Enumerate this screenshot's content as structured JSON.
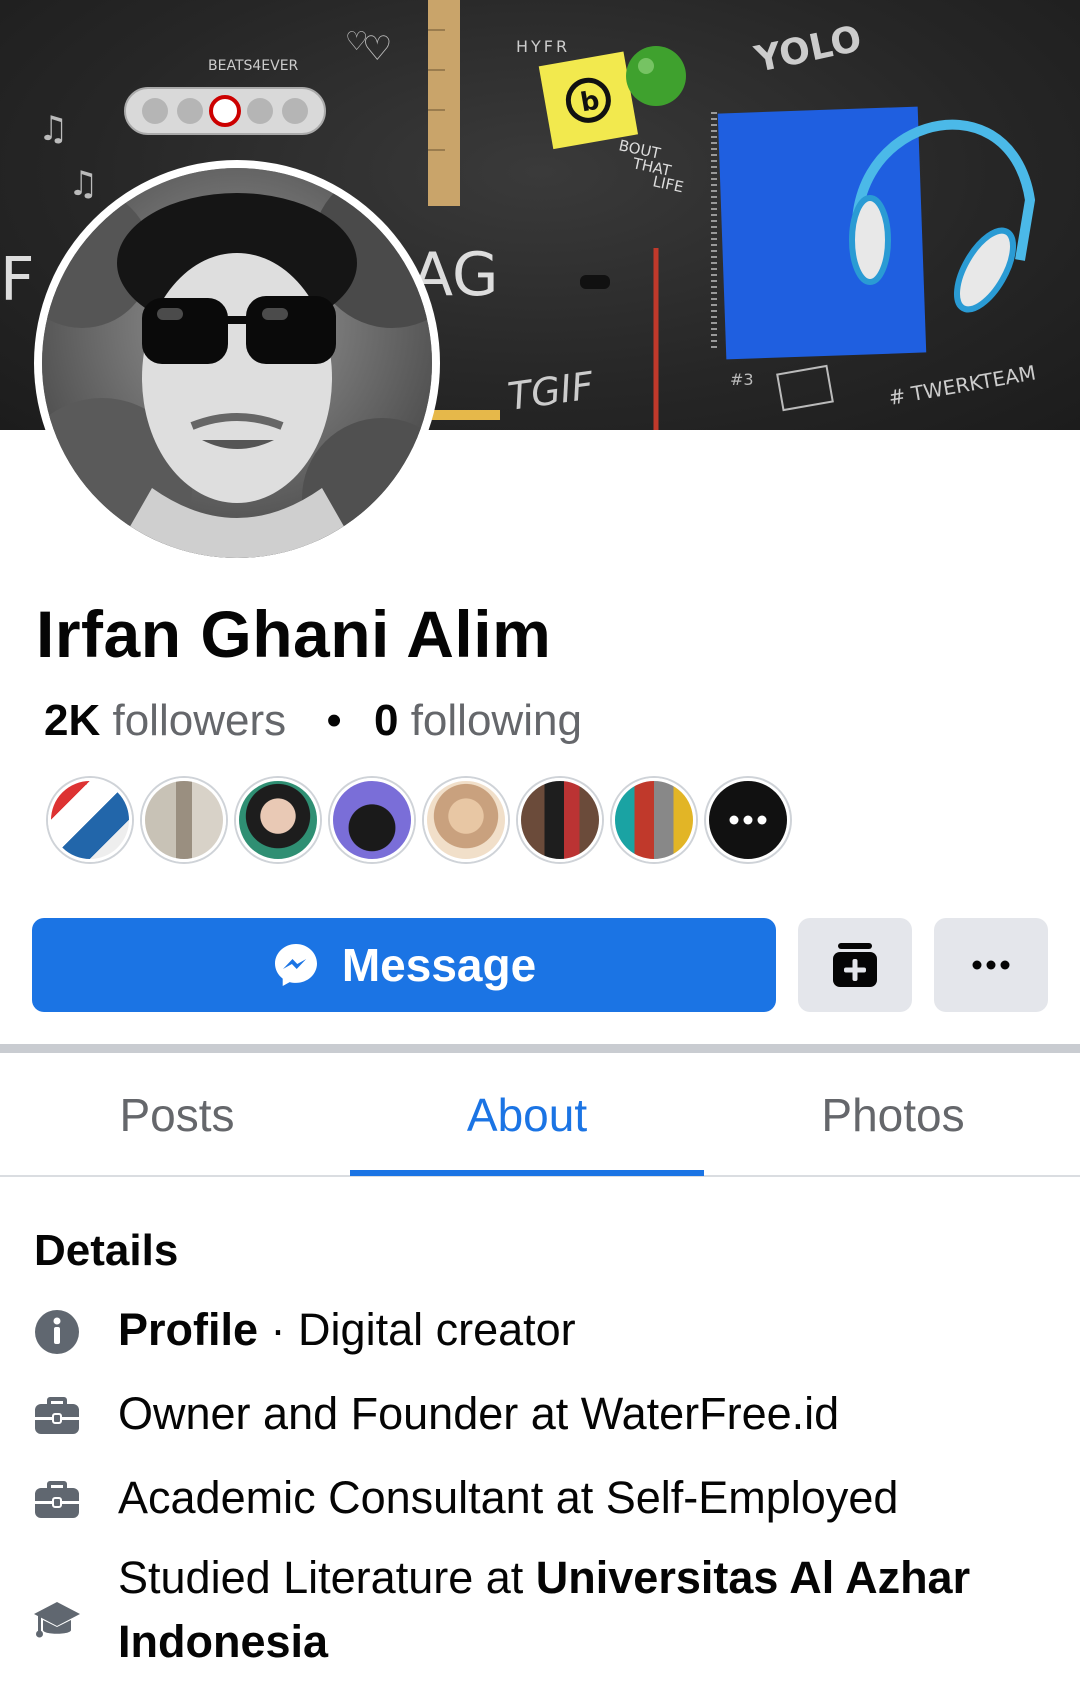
{
  "profile": {
    "name": "Irfan Ghani Alim",
    "followers_count": "2K",
    "followers_label": "followers",
    "separator": "•",
    "following_count": "0",
    "following_label": "following"
  },
  "cover": {
    "texts": {
      "beats": "BEATS4EVER",
      "hyfr": "HYFR",
      "yolo": "YOLO",
      "bout": "BOUT",
      "that": "THAT",
      "life": "LIFE",
      "ag": "AG",
      "f": "F",
      "tcif": "TGIF",
      "hashtag": "# TWERKTEAM",
      "num": "#3"
    }
  },
  "friends": {
    "count_visible": 7,
    "more_icon": "more-dots-icon"
  },
  "actions": {
    "message_label": "Message",
    "message_icon": "messenger-icon",
    "add_icon": "add-to-story-icon",
    "more_icon": "more-dots-icon"
  },
  "tabs": [
    {
      "label": "Posts"
    },
    {
      "label": "About",
      "active": true
    },
    {
      "label": "Photos"
    }
  ],
  "details": {
    "title": "Details",
    "rows": [
      {
        "icon": "info-icon",
        "bold": "Profile",
        "sep": " · ",
        "text": "Digital creator"
      },
      {
        "icon": "briefcase-icon",
        "text": "Owner and Founder at WaterFree.id"
      },
      {
        "icon": "briefcase-icon",
        "text": "Academic Consultant at Self-Employed"
      },
      {
        "icon": "graduation-cap-icon",
        "text": "Studied Literature at ",
        "bold": "Universitas Al Azhar Indonesia"
      }
    ]
  },
  "colors": {
    "accent": "#1b74e4",
    "secondary_text": "#65676b",
    "button_gray": "#e4e6eb"
  }
}
